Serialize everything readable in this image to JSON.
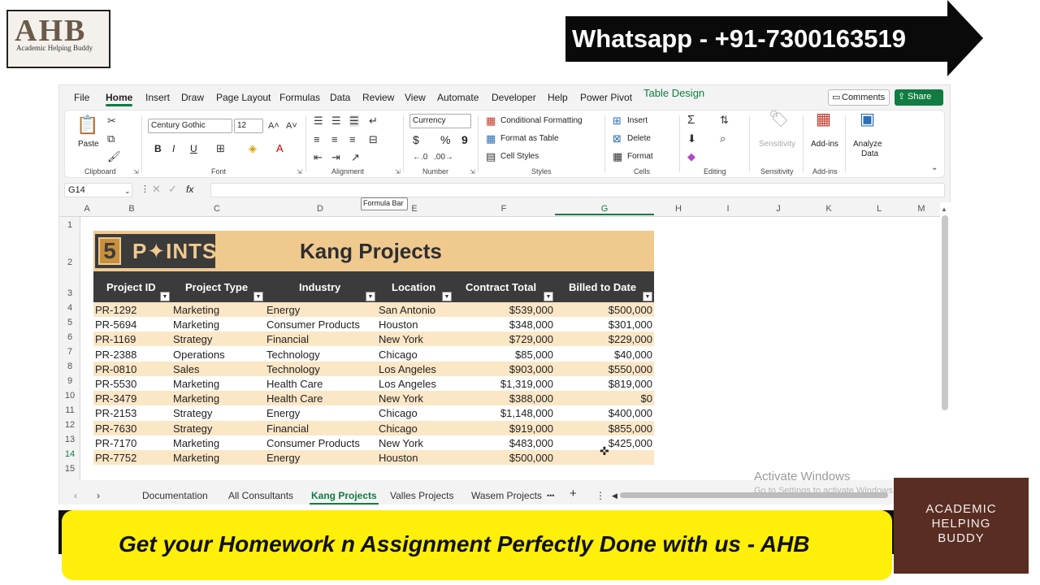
{
  "overlay": {
    "logo_big": "AHB",
    "logo_small": "Academic Helping Buddy",
    "whatsapp": "Whatsapp - +91-7300163519",
    "banner_text": "Get your Homework n Assignment Perfectly Done with us  - AHB",
    "card_lines": [
      "ACADEMIC",
      "HELPING",
      "BUDDY"
    ],
    "activate_title": "Activate Windows",
    "activate_sub": "Go to Settings to activate Windows."
  },
  "menu": {
    "items": [
      "File",
      "Home",
      "Insert",
      "Draw",
      "Page Layout",
      "Formulas",
      "Data",
      "Review",
      "View",
      "Automate",
      "Developer",
      "Help",
      "Power Pivot",
      "Table Design"
    ],
    "active": "Home",
    "comments": "Comments",
    "share": "Share"
  },
  "ribbon": {
    "clipboard": {
      "paste": "Paste",
      "label": "Clipboard"
    },
    "font": {
      "name": "Century Gothic",
      "size": "12",
      "label": "Font",
      "bold": "B",
      "italic": "I",
      "underline": "U"
    },
    "alignment": {
      "label": "Alignment"
    },
    "number": {
      "format": "Currency",
      "label": "Number",
      "dollar": "$",
      "percent": "%",
      "comma": "9"
    },
    "styles": {
      "conditional": "Conditional Formatting",
      "format_table": "Format as Table",
      "cell_styles": "Cell Styles",
      "label": "Styles"
    },
    "cells": {
      "insert": "Insert",
      "delete": "Delete",
      "format": "Format",
      "label": "Cells"
    },
    "editing": {
      "label": "Editing"
    },
    "sensitivity": {
      "label": "Sensitivity",
      "btn": "Sensitivity"
    },
    "addins": {
      "btn": "Add-ins",
      "label": "Add-ins"
    },
    "analyze": {
      "btn1": "Analyze",
      "btn2": "Data"
    }
  },
  "formula_bar": {
    "name_box": "G14",
    "fx": "fx",
    "tooltip": "Formula Bar"
  },
  "grid": {
    "columns": [
      "A",
      "B",
      "C",
      "D",
      "E",
      "F",
      "G",
      "H",
      "I",
      "J",
      "K",
      "L",
      "M"
    ],
    "rows": [
      "1",
      "2",
      "3",
      "4",
      "5",
      "6",
      "7",
      "8",
      "9",
      "10",
      "11",
      "12",
      "13",
      "14",
      "15"
    ],
    "selected_col": "G",
    "selected_row": "14"
  },
  "table": {
    "logo_num": "5",
    "logo_word": "P✦INTS",
    "title": "Kang Projects",
    "headers": [
      "Project ID",
      "Project Type",
      "Industry",
      "Location",
      "Contract Total",
      "Billed to Date"
    ],
    "rows": [
      [
        "PR-1292",
        "Marketing",
        "Energy",
        "San Antonio",
        "$539,000",
        "$500,000"
      ],
      [
        "PR-5694",
        "Marketing",
        "Consumer Products",
        "Houston",
        "$348,000",
        "$301,000"
      ],
      [
        "PR-1169",
        "Strategy",
        "Financial",
        "New York",
        "$729,000",
        "$229,000"
      ],
      [
        "PR-2388",
        "Operations",
        "Technology",
        "Chicago",
        "$85,000",
        "$40,000"
      ],
      [
        "PR-0810",
        "Sales",
        "Technology",
        "Los Angeles",
        "$903,000",
        "$550,000"
      ],
      [
        "PR-5530",
        "Marketing",
        "Health Care",
        "Los Angeles",
        "$1,319,000",
        "$819,000"
      ],
      [
        "PR-3479",
        "Marketing",
        "Health Care",
        "New York",
        "$388,000",
        "$0"
      ],
      [
        "PR-2153",
        "Strategy",
        "Energy",
        "Chicago",
        "$1,148,000",
        "$400,000"
      ],
      [
        "PR-7630",
        "Strategy",
        "Financial",
        "Chicago",
        "$919,000",
        "$855,000"
      ],
      [
        "PR-7170",
        "Marketing",
        "Consumer Products",
        "New York",
        "$483,000",
        "$425,000"
      ],
      [
        "PR-7752",
        "Marketing",
        "Energy",
        "Houston",
        "$500,000",
        ""
      ]
    ]
  },
  "sheets": {
    "tabs": [
      "Documentation",
      "All Consultants",
      "Kang Projects",
      "Valles Projects",
      "Wasem Projects"
    ],
    "active": "Kang Projects",
    "more": "•••",
    "add": "+"
  },
  "colors": {
    "accent": "#107c41",
    "table_header": "#3b3b3b",
    "band": "#f0c98f",
    "row_tint": "#fbe6c6"
  }
}
